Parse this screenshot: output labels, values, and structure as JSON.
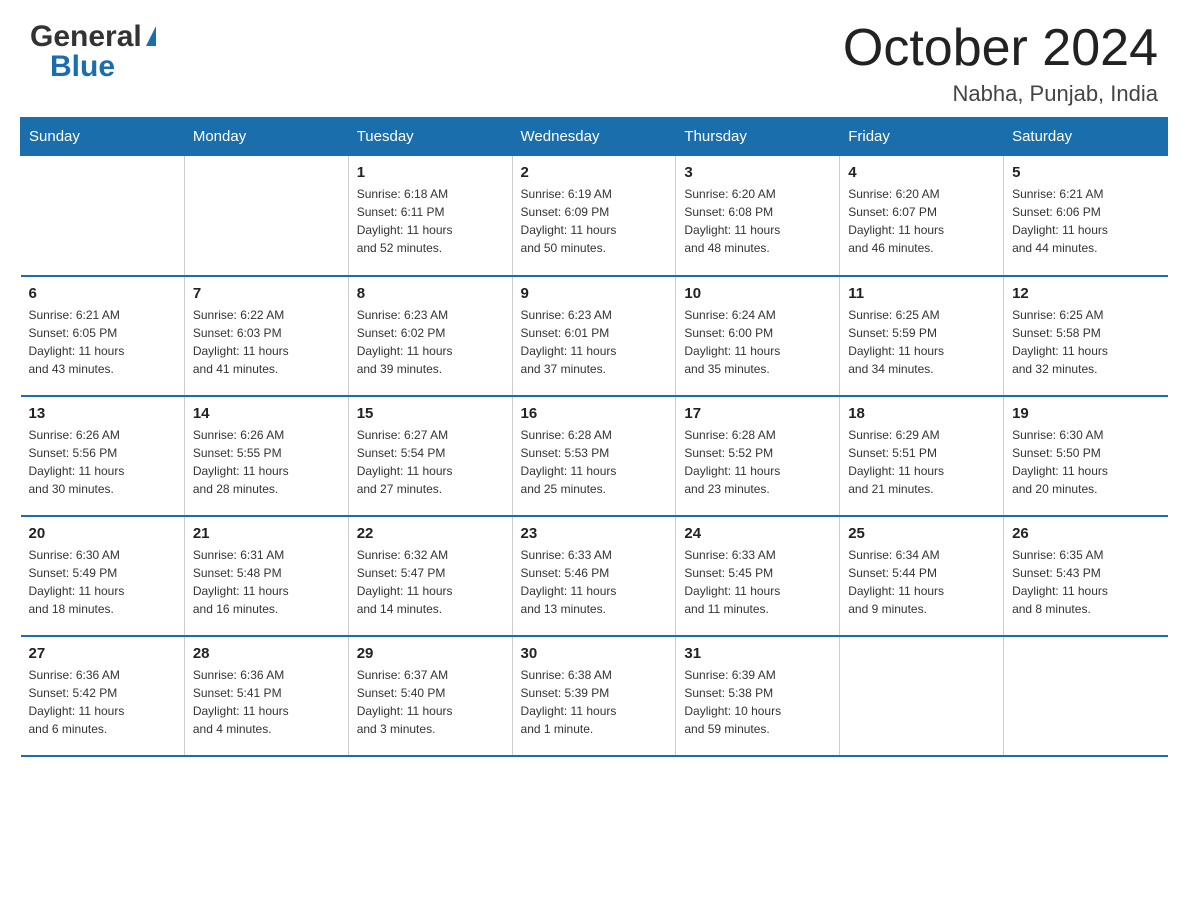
{
  "header": {
    "logo_general": "General",
    "logo_blue": "Blue",
    "month_title": "October 2024",
    "location": "Nabha, Punjab, India"
  },
  "days_of_week": [
    "Sunday",
    "Monday",
    "Tuesday",
    "Wednesday",
    "Thursday",
    "Friday",
    "Saturday"
  ],
  "weeks": [
    [
      {
        "day": "",
        "info": ""
      },
      {
        "day": "",
        "info": ""
      },
      {
        "day": "1",
        "info": "Sunrise: 6:18 AM\nSunset: 6:11 PM\nDaylight: 11 hours\nand 52 minutes."
      },
      {
        "day": "2",
        "info": "Sunrise: 6:19 AM\nSunset: 6:09 PM\nDaylight: 11 hours\nand 50 minutes."
      },
      {
        "day": "3",
        "info": "Sunrise: 6:20 AM\nSunset: 6:08 PM\nDaylight: 11 hours\nand 48 minutes."
      },
      {
        "day": "4",
        "info": "Sunrise: 6:20 AM\nSunset: 6:07 PM\nDaylight: 11 hours\nand 46 minutes."
      },
      {
        "day": "5",
        "info": "Sunrise: 6:21 AM\nSunset: 6:06 PM\nDaylight: 11 hours\nand 44 minutes."
      }
    ],
    [
      {
        "day": "6",
        "info": "Sunrise: 6:21 AM\nSunset: 6:05 PM\nDaylight: 11 hours\nand 43 minutes."
      },
      {
        "day": "7",
        "info": "Sunrise: 6:22 AM\nSunset: 6:03 PM\nDaylight: 11 hours\nand 41 minutes."
      },
      {
        "day": "8",
        "info": "Sunrise: 6:23 AM\nSunset: 6:02 PM\nDaylight: 11 hours\nand 39 minutes."
      },
      {
        "day": "9",
        "info": "Sunrise: 6:23 AM\nSunset: 6:01 PM\nDaylight: 11 hours\nand 37 minutes."
      },
      {
        "day": "10",
        "info": "Sunrise: 6:24 AM\nSunset: 6:00 PM\nDaylight: 11 hours\nand 35 minutes."
      },
      {
        "day": "11",
        "info": "Sunrise: 6:25 AM\nSunset: 5:59 PM\nDaylight: 11 hours\nand 34 minutes."
      },
      {
        "day": "12",
        "info": "Sunrise: 6:25 AM\nSunset: 5:58 PM\nDaylight: 11 hours\nand 32 minutes."
      }
    ],
    [
      {
        "day": "13",
        "info": "Sunrise: 6:26 AM\nSunset: 5:56 PM\nDaylight: 11 hours\nand 30 minutes."
      },
      {
        "day": "14",
        "info": "Sunrise: 6:26 AM\nSunset: 5:55 PM\nDaylight: 11 hours\nand 28 minutes."
      },
      {
        "day": "15",
        "info": "Sunrise: 6:27 AM\nSunset: 5:54 PM\nDaylight: 11 hours\nand 27 minutes."
      },
      {
        "day": "16",
        "info": "Sunrise: 6:28 AM\nSunset: 5:53 PM\nDaylight: 11 hours\nand 25 minutes."
      },
      {
        "day": "17",
        "info": "Sunrise: 6:28 AM\nSunset: 5:52 PM\nDaylight: 11 hours\nand 23 minutes."
      },
      {
        "day": "18",
        "info": "Sunrise: 6:29 AM\nSunset: 5:51 PM\nDaylight: 11 hours\nand 21 minutes."
      },
      {
        "day": "19",
        "info": "Sunrise: 6:30 AM\nSunset: 5:50 PM\nDaylight: 11 hours\nand 20 minutes."
      }
    ],
    [
      {
        "day": "20",
        "info": "Sunrise: 6:30 AM\nSunset: 5:49 PM\nDaylight: 11 hours\nand 18 minutes."
      },
      {
        "day": "21",
        "info": "Sunrise: 6:31 AM\nSunset: 5:48 PM\nDaylight: 11 hours\nand 16 minutes."
      },
      {
        "day": "22",
        "info": "Sunrise: 6:32 AM\nSunset: 5:47 PM\nDaylight: 11 hours\nand 14 minutes."
      },
      {
        "day": "23",
        "info": "Sunrise: 6:33 AM\nSunset: 5:46 PM\nDaylight: 11 hours\nand 13 minutes."
      },
      {
        "day": "24",
        "info": "Sunrise: 6:33 AM\nSunset: 5:45 PM\nDaylight: 11 hours\nand 11 minutes."
      },
      {
        "day": "25",
        "info": "Sunrise: 6:34 AM\nSunset: 5:44 PM\nDaylight: 11 hours\nand 9 minutes."
      },
      {
        "day": "26",
        "info": "Sunrise: 6:35 AM\nSunset: 5:43 PM\nDaylight: 11 hours\nand 8 minutes."
      }
    ],
    [
      {
        "day": "27",
        "info": "Sunrise: 6:36 AM\nSunset: 5:42 PM\nDaylight: 11 hours\nand 6 minutes."
      },
      {
        "day": "28",
        "info": "Sunrise: 6:36 AM\nSunset: 5:41 PM\nDaylight: 11 hours\nand 4 minutes."
      },
      {
        "day": "29",
        "info": "Sunrise: 6:37 AM\nSunset: 5:40 PM\nDaylight: 11 hours\nand 3 minutes."
      },
      {
        "day": "30",
        "info": "Sunrise: 6:38 AM\nSunset: 5:39 PM\nDaylight: 11 hours\nand 1 minute."
      },
      {
        "day": "31",
        "info": "Sunrise: 6:39 AM\nSunset: 5:38 PM\nDaylight: 10 hours\nand 59 minutes."
      },
      {
        "day": "",
        "info": ""
      },
      {
        "day": "",
        "info": ""
      }
    ]
  ]
}
